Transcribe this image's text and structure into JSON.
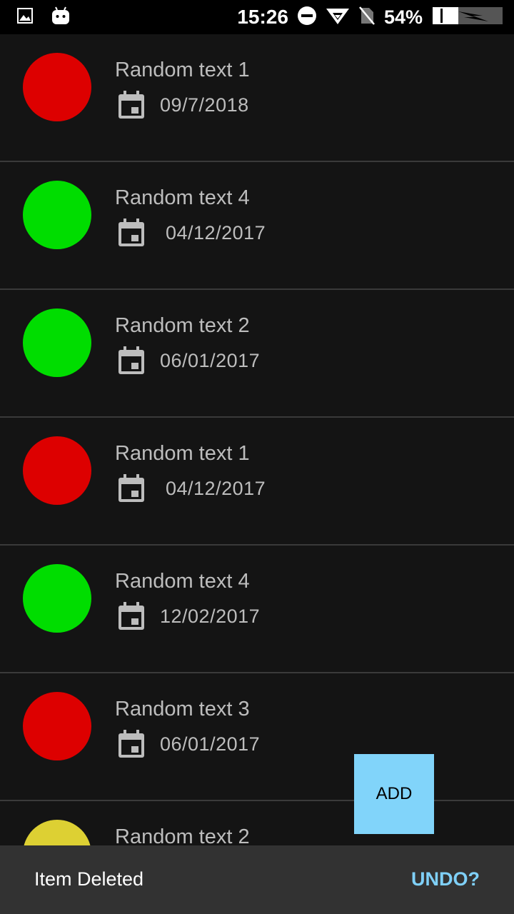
{
  "status_bar": {
    "time": "15:26",
    "battery": "54%",
    "icons": [
      "image-icon",
      "android-icon",
      "do-not-disturb-icon",
      "wifi-icon",
      "no-sim-icon",
      "battery-icon"
    ]
  },
  "list": {
    "items": [
      {
        "title": "Random text 1",
        "date": "09/7/2018",
        "status_color": "#dd0000"
      },
      {
        "title": "Random text 4",
        "date": "04/12/2017",
        "status_color": "#00dd00"
      },
      {
        "title": "Random text 2",
        "date": "06/01/2017",
        "status_color": "#00dd00"
      },
      {
        "title": "Random text 1",
        "date": "04/12/2017",
        "status_color": "#dd0000"
      },
      {
        "title": "Random text 4",
        "date": "12/02/2017",
        "status_color": "#00dd00"
      },
      {
        "title": "Random text 3",
        "date": "06/01/2017",
        "status_color": "#dd0000"
      },
      {
        "title": "Random text 2",
        "date": "",
        "status_color": "#ddd033"
      }
    ]
  },
  "fab": {
    "label": "ADD",
    "color": "#81d4fa"
  },
  "snackbar": {
    "message": "Item Deleted",
    "action": "UNDO?",
    "action_color": "#7fd0f8"
  }
}
